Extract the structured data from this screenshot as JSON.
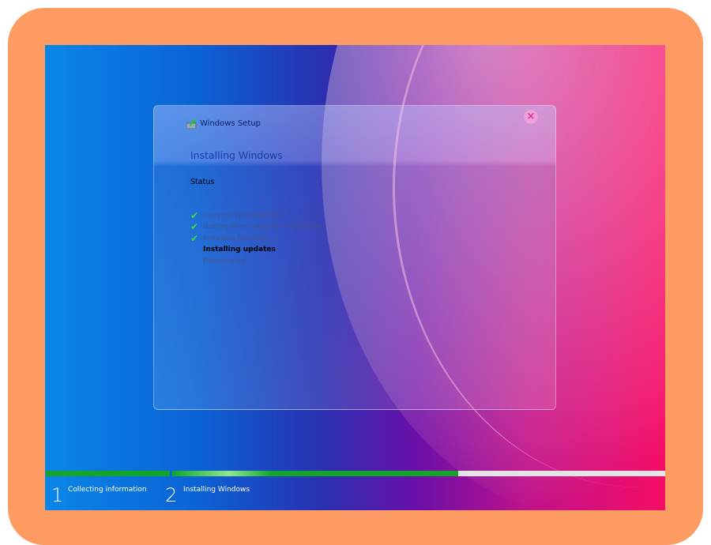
{
  "dialog": {
    "title": "Windows Setup",
    "heading": "Installing Windows",
    "status_label": "Status",
    "close_icon": "×",
    "steps": [
      {
        "label": "Copying Windows files",
        "done": true
      },
      {
        "label": "Getting files ready for installation",
        "done": true
      },
      {
        "label": "Installing features",
        "done": true
      },
      {
        "label": "Installing updates",
        "current": true
      },
      {
        "label": "Finishing up"
      }
    ]
  },
  "progress": {
    "phases": [
      {
        "number": "1",
        "label": "Collecting information",
        "percent": 100
      },
      {
        "number": "2",
        "label": "Installing Windows",
        "percent": 58
      }
    ],
    "color": "#12a52a"
  },
  "check_glyph": "✔"
}
